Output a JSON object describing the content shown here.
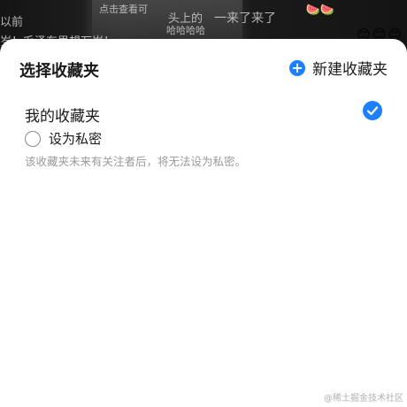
{
  "background": {
    "danmaku": [
      "以前",
      "头上的",
      "点击查看可",
      "一来了来了",
      "哈哈哈哈",
      "岁！毛泽东思想万岁！"
    ],
    "emoji_right": "😊😊😊",
    "emoji_mid": "🍉🍉"
  },
  "sheet": {
    "title": "选择收藏夹",
    "new_folder_label": "新建收藏夹",
    "folders": [
      {
        "name": "我的收藏夹",
        "selected": true
      }
    ],
    "private_label": "设为私密",
    "hint": "该收藏夹未来有关注者后，将无法设为私密。"
  },
  "watermark": "@稀土掘金技术社区",
  "colors": {
    "accent": "#1e80ff",
    "title_text": "#1a1a1a",
    "hint_text": "#999999"
  }
}
